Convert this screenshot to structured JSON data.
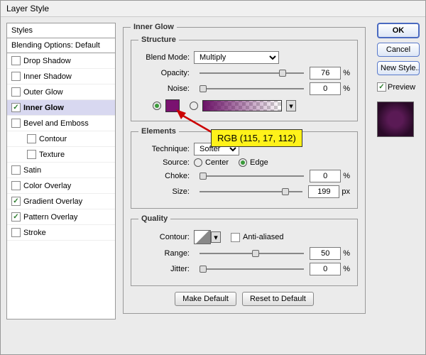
{
  "window": {
    "title": "Layer Style"
  },
  "styles_panel": {
    "header": "Styles",
    "blending_header": "Blending Options: Default",
    "items": [
      {
        "label": "Drop Shadow",
        "checked": false,
        "selected": false,
        "indent": false
      },
      {
        "label": "Inner Shadow",
        "checked": false,
        "selected": false,
        "indent": false
      },
      {
        "label": "Outer Glow",
        "checked": false,
        "selected": false,
        "indent": false
      },
      {
        "label": "Inner Glow",
        "checked": true,
        "selected": true,
        "indent": false
      },
      {
        "label": "Bevel and Emboss",
        "checked": false,
        "selected": false,
        "indent": false
      },
      {
        "label": "Contour",
        "checked": false,
        "selected": false,
        "indent": true
      },
      {
        "label": "Texture",
        "checked": false,
        "selected": false,
        "indent": true
      },
      {
        "label": "Satin",
        "checked": false,
        "selected": false,
        "indent": false
      },
      {
        "label": "Color Overlay",
        "checked": false,
        "selected": false,
        "indent": false
      },
      {
        "label": "Gradient Overlay",
        "checked": true,
        "selected": false,
        "indent": false
      },
      {
        "label": "Pattern Overlay",
        "checked": true,
        "selected": false,
        "indent": false
      },
      {
        "label": "Stroke",
        "checked": false,
        "selected": false,
        "indent": false
      }
    ]
  },
  "main": {
    "title": "Inner Glow",
    "structure": {
      "legend": "Structure",
      "blend_mode_label": "Blend Mode:",
      "blend_mode_value": "Multiply",
      "opacity_label": "Opacity:",
      "opacity_value": "76",
      "opacity_unit": "%",
      "noise_label": "Noise:",
      "noise_value": "0",
      "noise_unit": "%",
      "color_hex": "#731170",
      "color_selected": "solid"
    },
    "elements": {
      "legend": "Elements",
      "technique_label": "Technique:",
      "technique_value": "Softer",
      "source_label": "Source:",
      "source_center": "Center",
      "source_edge": "Edge",
      "source_value": "Edge",
      "choke_label": "Choke:",
      "choke_value": "0",
      "choke_unit": "%",
      "size_label": "Size:",
      "size_value": "199",
      "size_unit": "px"
    },
    "quality": {
      "legend": "Quality",
      "contour_label": "Contour:",
      "aa_label": "Anti-aliased",
      "aa_checked": false,
      "range_label": "Range:",
      "range_value": "50",
      "range_unit": "%",
      "jitter_label": "Jitter:",
      "jitter_value": "0",
      "jitter_unit": "%"
    },
    "make_default": "Make Default",
    "reset_default": "Reset to Default"
  },
  "right": {
    "ok": "OK",
    "cancel": "Cancel",
    "new_style": "New Style...",
    "preview_label": "Preview",
    "preview_checked": true
  },
  "annotation": {
    "text": "RGB (115, 17, 112)"
  }
}
